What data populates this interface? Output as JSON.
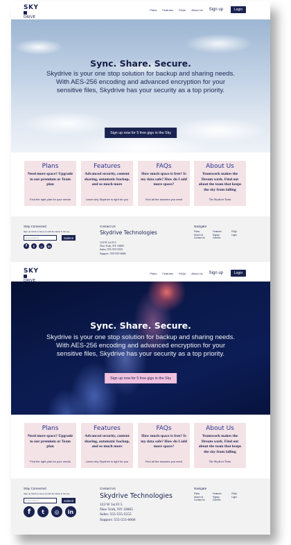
{
  "logo": {
    "top": "SKY",
    "bottom": "DRIVE"
  },
  "nav": {
    "links": [
      "Plans",
      "Features",
      "FAQs",
      "About Us"
    ],
    "signup": "Sign up",
    "login": "Login"
  },
  "hero": {
    "title": "Sync. Share. Secure.",
    "body": "Skydrive is your one stop solution for backup and sharing needs. With AES-256 encoding and advanced encryption for your sensitive files, Skydrive has your security as a top priority.",
    "cta": "Sign up now for 5 free gigs in the Sky"
  },
  "cards": [
    {
      "title": "Plans",
      "body": "Need more space? Upgrade to our premium or Team plan",
      "footer": "Find the right plan for your needs"
    },
    {
      "title": "Features",
      "body": "Advanced security, content sharing, automatic backup, and so much more",
      "footer": "Learn why Skydrive is right for you"
    },
    {
      "title": "FAQs",
      "body": "How much space is free? Is my data safe? How do I add more space?",
      "footer": "Find all the answers you need"
    },
    {
      "title": "About Us",
      "body": "Yeamwork makes the Dream work. Find out about the team that keeps the sky from falling",
      "footer": "The Skydrive Team"
    }
  ],
  "footer": {
    "stay_connected": "Stay Connected",
    "newsletter_note": "Sign up below to keep up with the latest in the sky",
    "email_placeholder": "Email Address",
    "submit": "Submit",
    "social_icons": [
      "facebook-icon",
      "twitter-icon",
      "instagram-icon",
      "linkedin-icon"
    ],
    "contact_us": "Contact Us",
    "company": "Skydrive Technologies",
    "address": [
      "123 W 1st Fl 5",
      "New York, NY 10005",
      "Sales: 555-555-5555",
      "Support: 555-555-6666"
    ],
    "navigate": "Navigate",
    "nav_links": [
      "Plans",
      "Features",
      "FAQs",
      "About Us",
      "Signup",
      "Login",
      "Contact Us",
      "Careers"
    ]
  },
  "colors": {
    "navy": "#1a2250",
    "card_pink": "#f3e2e6",
    "cta_pink": "#f0c2de",
    "footer_gray": "#f2f2f2"
  }
}
